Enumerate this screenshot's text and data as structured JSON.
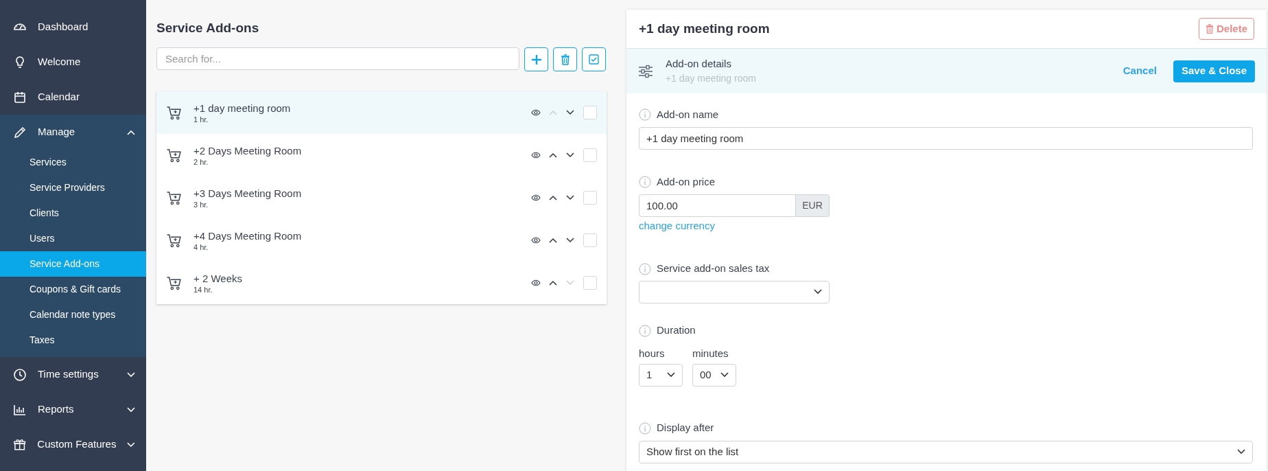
{
  "sidebar": {
    "items": [
      {
        "label": "Dashboard"
      },
      {
        "label": "Welcome"
      },
      {
        "label": "Calendar"
      },
      {
        "label": "Manage",
        "expanded": true,
        "children": [
          {
            "label": "Services",
            "selected": false
          },
          {
            "label": "Service Providers",
            "selected": false
          },
          {
            "label": "Clients",
            "selected": false
          },
          {
            "label": "Users",
            "selected": false
          },
          {
            "label": "Service Add-ons",
            "selected": true
          },
          {
            "label": "Coupons & Gift cards",
            "selected": false
          },
          {
            "label": "Calendar note types",
            "selected": false
          },
          {
            "label": "Taxes",
            "selected": false
          }
        ]
      },
      {
        "label": "Time settings",
        "expanded": false
      },
      {
        "label": "Reports",
        "expanded": false
      },
      {
        "label": "Custom Features",
        "expanded": false
      }
    ]
  },
  "list_panel": {
    "title": "Service Add-ons",
    "search": {
      "placeholder": "Search for..."
    },
    "items": [
      {
        "name": "+1 day meeting room",
        "duration": "1 hr.",
        "selected": true,
        "move_up_disabled": true,
        "move_down_disabled": false,
        "checked": false
      },
      {
        "name": "+2 Days Meeting Room",
        "duration": "2 hr.",
        "selected": false,
        "move_up_disabled": false,
        "move_down_disabled": false,
        "checked": false
      },
      {
        "name": "+3 Days Meeting Room",
        "duration": "3 hr.",
        "selected": false,
        "move_up_disabled": false,
        "move_down_disabled": false,
        "checked": false
      },
      {
        "name": "+4 Days Meeting Room",
        "duration": "4 hr.",
        "selected": false,
        "move_up_disabled": false,
        "move_down_disabled": false,
        "checked": false
      },
      {
        "name": "+ 2 Weeks",
        "duration": "14 hr.",
        "selected": false,
        "move_up_disabled": false,
        "move_down_disabled": true,
        "checked": false
      }
    ]
  },
  "detail_panel": {
    "title": "+1 day meeting room",
    "delete_button": "Delete",
    "section": {
      "title": "Add-on details",
      "subtitle": "+1 day meeting room",
      "cancel": "Cancel",
      "save": "Save & Close"
    },
    "name_field": {
      "label": "Add-on name",
      "value": "+1 day meeting room"
    },
    "price_field": {
      "label": "Add-on price",
      "value": "100.00",
      "currency": "EUR",
      "link": "change currency"
    },
    "tax_field": {
      "label": "Service add-on sales tax"
    },
    "duration": {
      "label": "Duration",
      "hours_label": "hours",
      "hours_value": "1",
      "minutes_label": "minutes",
      "minutes_value": "00"
    },
    "display_after": {
      "label": "Display after",
      "value": "Show first on the list"
    }
  }
}
